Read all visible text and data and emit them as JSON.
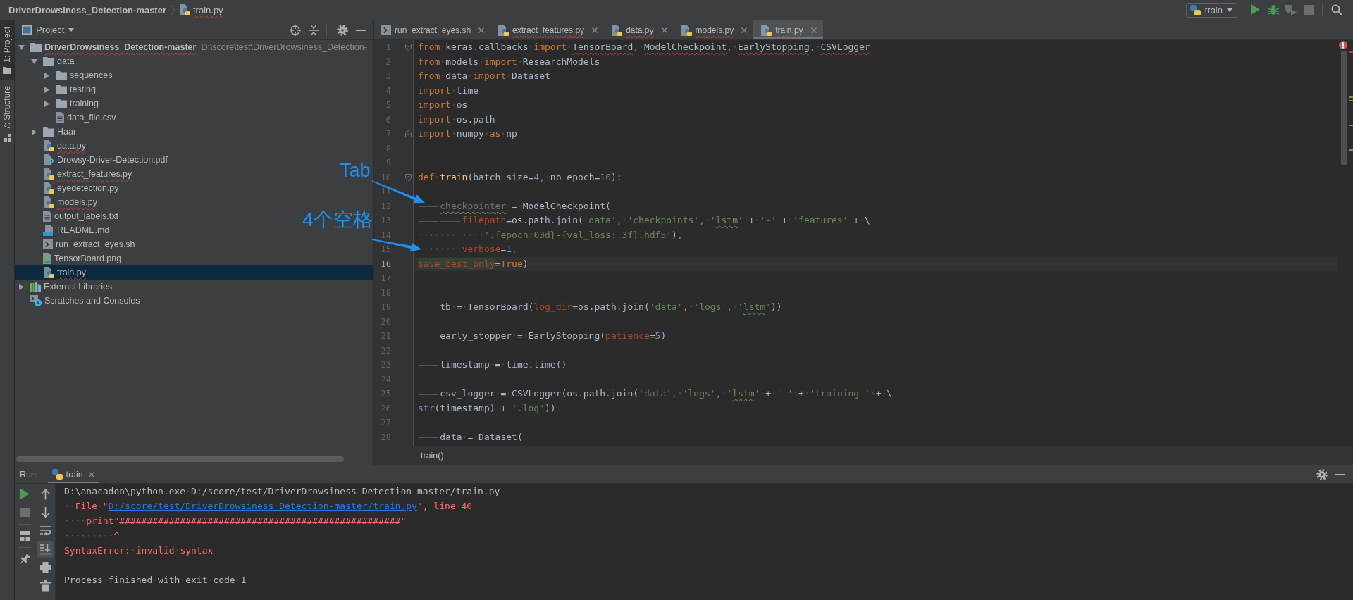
{
  "navigation_bar": {
    "breadcrumbs": [
      {
        "label": "DriverDrowsiness_Detection-master",
        "kind": "project",
        "errors": false
      },
      {
        "label": "train.py",
        "kind": "python",
        "errors": true
      }
    ],
    "run_configuration": {
      "label": "train"
    },
    "toolbar": [
      {
        "kind": "run",
        "disabled": false
      },
      {
        "kind": "debug",
        "disabled": false
      },
      {
        "kind": "coverage",
        "disabled": true
      },
      {
        "kind": "stop",
        "disabled": true
      },
      {
        "kind": "search",
        "disabled": false
      }
    ]
  },
  "tool_window_bar": [
    {
      "label": "1: Project",
      "kind": "project",
      "selected": true
    },
    {
      "label": "7: Structure",
      "kind": "structure",
      "selected": false
    }
  ],
  "project_panel": {
    "title": "Project",
    "tree": [
      {
        "label": "DriverDrowsiness_Detection-master",
        "path": "D:\\score\\test\\DriverDrowsiness_Detection-",
        "kind": "project",
        "expanded": true,
        "selected": false,
        "errors": true,
        "children": [
          {
            "label": "data",
            "kind": "folder",
            "expanded": true,
            "selected": false,
            "errors": false,
            "children": [
              {
                "label": "sequences",
                "kind": "folder",
                "expanded": false,
                "selected": false,
                "errors": false
              },
              {
                "label": "testing",
                "kind": "folder",
                "expanded": false,
                "selected": false,
                "errors": false
              },
              {
                "label": "training",
                "kind": "folder",
                "expanded": false,
                "selected": false,
                "errors": false
              },
              {
                "label": "data_file.csv",
                "kind": "csv",
                "selected": false,
                "errors": false
              }
            ]
          },
          {
            "label": "Haar",
            "kind": "folder",
            "expanded": false,
            "selected": false,
            "errors": false
          },
          {
            "label": "data.py",
            "kind": "python",
            "selected": false,
            "errors": true
          },
          {
            "label": "Drowsy-Driver-Detection.pdf",
            "kind": "unknown",
            "selected": false,
            "errors": false
          },
          {
            "label": "extract_features.py",
            "kind": "python",
            "selected": false,
            "errors": true
          },
          {
            "label": "eyedetection.py",
            "kind": "python",
            "selected": false,
            "errors": false
          },
          {
            "label": "models.py",
            "kind": "python",
            "selected": false,
            "errors": true
          },
          {
            "label": "output_labels.txt",
            "kind": "text",
            "selected": false,
            "errors": false
          },
          {
            "label": "README.md",
            "kind": "markdown",
            "selected": false,
            "errors": false
          },
          {
            "label": "run_extract_eyes.sh",
            "kind": "shell",
            "selected": false,
            "errors": false
          },
          {
            "label": "TensorBoard.png",
            "kind": "image",
            "selected": false,
            "errors": false
          },
          {
            "label": "train.py",
            "kind": "python",
            "selected": true,
            "errors": true
          }
        ]
      },
      {
        "label": "External Libraries",
        "kind": "libraries",
        "expanded": false,
        "selected": false,
        "errors": false
      },
      {
        "label": "Scratches and Consoles",
        "kind": "scratches",
        "selected": false,
        "errors": false
      }
    ]
  },
  "editor": {
    "tabs": [
      {
        "label": "run_extract_eyes.sh",
        "kind": "shell",
        "selected": false,
        "errors": false
      },
      {
        "label": "extract_features.py",
        "kind": "python",
        "selected": false,
        "errors": true
      },
      {
        "label": "data.py",
        "kind": "python",
        "selected": false,
        "errors": true
      },
      {
        "label": "models.py",
        "kind": "python",
        "selected": false,
        "errors": true
      },
      {
        "label": "train.py",
        "kind": "python",
        "selected": true,
        "errors": true
      }
    ],
    "lines": [
      {
        "number": "1",
        "current": false,
        "fold": {
          "kind": "start"
        },
        "tokens": [
          {
            "text": "from",
            "kind": "keyword"
          },
          {
            "text": " keras.callbacks ",
            "kind": "plain"
          },
          {
            "text": "import ",
            "kind": "keyword"
          },
          {
            "text": "TensorBoard",
            "kind": "unresolved"
          },
          {
            "text": ", ",
            "kind": "punctuation"
          },
          {
            "text": "ModelCheckpoint",
            "kind": "unresolved"
          },
          {
            "text": ", ",
            "kind": "punctuation"
          },
          {
            "text": "EarlyStopping",
            "kind": "unresolved"
          },
          {
            "text": ", ",
            "kind": "punctuation"
          },
          {
            "text": "CSVLogger",
            "kind": "unresolved"
          }
        ]
      },
      {
        "number": "2",
        "current": false,
        "tokens": [
          {
            "text": "from",
            "kind": "keyword"
          },
          {
            "text": " models ",
            "kind": "plain"
          },
          {
            "text": "import",
            "kind": "keyword"
          },
          {
            "text": " ResearchModels",
            "kind": "plain"
          }
        ]
      },
      {
        "number": "3",
        "current": false,
        "tokens": [
          {
            "text": "from",
            "kind": "keyword"
          },
          {
            "text": " data ",
            "kind": "plain"
          },
          {
            "text": "import",
            "kind": "keyword"
          },
          {
            "text": " Dataset",
            "kind": "plain"
          }
        ]
      },
      {
        "number": "4",
        "current": false,
        "tokens": [
          {
            "text": "import",
            "kind": "keyword"
          },
          {
            "text": " time",
            "kind": "plain"
          }
        ]
      },
      {
        "number": "5",
        "current": false,
        "tokens": [
          {
            "text": "import",
            "kind": "keyword"
          },
          {
            "text": " os",
            "kind": "plain"
          }
        ]
      },
      {
        "number": "6",
        "current": false,
        "tokens": [
          {
            "text": "import",
            "kind": "keyword"
          },
          {
            "text": " os.path",
            "kind": "plain"
          }
        ]
      },
      {
        "number": "7",
        "current": false,
        "fold": {
          "kind": "end"
        },
        "tokens": [
          {
            "text": "import",
            "kind": "keyword"
          },
          {
            "text": " numpy ",
            "kind": "plain"
          },
          {
            "text": "as",
            "kind": "keyword"
          },
          {
            "text": " np",
            "kind": "plain"
          }
        ]
      },
      {
        "number": "8",
        "current": false
      },
      {
        "number": "9",
        "current": false
      },
      {
        "number": "10",
        "current": false,
        "fold": {
          "kind": "start"
        },
        "tokens": [
          {
            "text": "def ",
            "kind": "keyword"
          },
          {
            "text": "train",
            "kind": "function"
          },
          {
            "text": "(batch_size=",
            "kind": "plain"
          },
          {
            "text": "4",
            "kind": "number"
          },
          {
            "text": ", ",
            "kind": "punctuation"
          },
          {
            "text": "nb_epoch=",
            "kind": "plain"
          },
          {
            "text": "10",
            "kind": "number"
          },
          {
            "text": "):",
            "kind": "plain"
          }
        ]
      },
      {
        "number": "11",
        "current": false
      },
      {
        "number": "12",
        "current": false,
        "tokens": [
          {
            "text": "\tcheckpointer",
            "kind": "unused"
          },
          {
            "text": " = ModelCheckpoint(",
            "kind": "plain"
          }
        ]
      },
      {
        "number": "13",
        "current": false,
        "tokens": [
          {
            "text": "\t\tfilepath",
            "kind": "param"
          },
          {
            "text": "=os.path.join(",
            "kind": "plain"
          },
          {
            "text": "'data'",
            "kind": "string"
          },
          {
            "text": ", ",
            "kind": "punctuation"
          },
          {
            "text": "'checkpoints'",
            "kind": "string"
          },
          {
            "text": ", ",
            "kind": "punctuation"
          },
          {
            "text": "'",
            "kind": "string"
          },
          {
            "text": "lstm",
            "kind": "typo"
          },
          {
            "text": "'",
            "kind": "string"
          },
          {
            "text": " + ",
            "kind": "plain"
          },
          {
            "text": "'-'",
            "kind": "string"
          },
          {
            "text": " + ",
            "kind": "plain"
          },
          {
            "text": "'features'",
            "kind": "string"
          },
          {
            "text": " + \\",
            "kind": "plain"
          }
        ]
      },
      {
        "number": "14",
        "current": false,
        "tokens": [
          {
            "text": "            '.{epoch:03d}-{val_loss:.3f}.hdf5'",
            "kind": "string"
          },
          {
            "text": ")",
            "kind": "plain"
          },
          {
            "text": ",",
            "kind": "punctuation"
          }
        ]
      },
      {
        "number": "15",
        "current": false,
        "tokens": [
          {
            "text": "        verbose",
            "kind": "param"
          },
          {
            "text": "=",
            "kind": "plain"
          },
          {
            "text": "1",
            "kind": "number"
          },
          {
            "text": ",",
            "kind": "punctuation"
          }
        ]
      },
      {
        "number": "16",
        "current": true,
        "tokens": [
          {
            "text": "save_best_only",
            "kind": "param_match"
          },
          {
            "text": "=",
            "kind": "plain"
          },
          {
            "text": "True",
            "kind": "keyword"
          },
          {
            "text": ")",
            "kind": "plain"
          }
        ]
      },
      {
        "number": "17",
        "current": false
      },
      {
        "number": "18",
        "current": false
      },
      {
        "number": "19",
        "current": false,
        "tokens": [
          {
            "text": "\ttb = TensorBoard(",
            "kind": "plain"
          },
          {
            "text": "log_dir",
            "kind": "param"
          },
          {
            "text": "=os.path.join(",
            "kind": "plain"
          },
          {
            "text": "'data'",
            "kind": "string"
          },
          {
            "text": ", ",
            "kind": "punctuation"
          },
          {
            "text": "'logs'",
            "kind": "string"
          },
          {
            "text": ", ",
            "kind": "punctuation"
          },
          {
            "text": "'",
            "kind": "string"
          },
          {
            "text": "lstm",
            "kind": "typo"
          },
          {
            "text": "'",
            "kind": "string"
          },
          {
            "text": "))",
            "kind": "plain"
          }
        ]
      },
      {
        "number": "20",
        "current": false
      },
      {
        "number": "21",
        "current": false,
        "tokens": [
          {
            "text": "\tearly_stopper = EarlyStopping(",
            "kind": "plain"
          },
          {
            "text": "patience",
            "kind": "param"
          },
          {
            "text": "=",
            "kind": "plain"
          },
          {
            "text": "5",
            "kind": "number"
          },
          {
            "text": ")",
            "kind": "plain"
          }
        ]
      },
      {
        "number": "22",
        "current": false
      },
      {
        "number": "23",
        "current": false,
        "tokens": [
          {
            "text": "\ttimestamp = time.time()",
            "kind": "plain"
          }
        ]
      },
      {
        "number": "24",
        "current": false
      },
      {
        "number": "25",
        "current": false,
        "tokens": [
          {
            "text": "\tcsv_logger = CSVLogger(os.path.join(",
            "kind": "plain"
          },
          {
            "text": "'data'",
            "kind": "string"
          },
          {
            "text": ", ",
            "kind": "punctuation"
          },
          {
            "text": "'logs'",
            "kind": "string"
          },
          {
            "text": ", ",
            "kind": "punctuation"
          },
          {
            "text": "'",
            "kind": "string"
          },
          {
            "text": "lstm",
            "kind": "typo"
          },
          {
            "text": "'",
            "kind": "string"
          },
          {
            "text": " + ",
            "kind": "plain"
          },
          {
            "text": "'-'",
            "kind": "string"
          },
          {
            "text": " + ",
            "kind": "plain"
          },
          {
            "text": "'training-'",
            "kind": "string"
          },
          {
            "text": " + \\",
            "kind": "plain"
          }
        ]
      },
      {
        "number": "26",
        "current": false,
        "tokens": [
          {
            "text": "str",
            "kind": "builtin"
          },
          {
            "text": "(timestamp) + ",
            "kind": "plain"
          },
          {
            "text": "'.log'",
            "kind": "string"
          },
          {
            "text": "))",
            "kind": "plain"
          }
        ]
      },
      {
        "number": "27",
        "current": false
      },
      {
        "number": "28",
        "current": false,
        "tokens": [
          {
            "text": "\tdata = Dataset(",
            "kind": "plain"
          }
        ]
      }
    ],
    "breadcrumb": "train()"
  },
  "run_panel": {
    "title": "Run:",
    "tabs": [
      {
        "label": "train",
        "selected": true
      }
    ],
    "toolbar": [
      {
        "groups": [
          {
            "buttons": [
              {
                "kind": "rerun",
                "disabled": false,
                "on": false
              },
              {
                "kind": "stop",
                "disabled": true,
                "on": false
              }
            ]
          },
          {
            "buttons": [
              {
                "kind": "layout",
                "disabled": false,
                "on": false
              }
            ]
          },
          {
            "buttons": [
              {
                "kind": "pin",
                "disabled": false,
                "on": false
              }
            ]
          }
        ]
      },
      {
        "groups": [
          {
            "buttons": [
              {
                "kind": "up",
                "disabled": false,
                "on": false
              },
              {
                "kind": "down",
                "disabled": false,
                "on": false
              },
              {
                "kind": "wrap",
                "disabled": false,
                "on": false
              },
              {
                "kind": "scroll_end",
                "disabled": false,
                "on": true
              },
              {
                "kind": "print",
                "disabled": false,
                "on": false
              },
              {
                "kind": "trash",
                "disabled": false,
                "on": false
              }
            ]
          }
        ]
      }
    ],
    "console": [
      {
        "kind": "stdout",
        "segments": [
          {
            "text": "D:\\anacadon\\python.exe D:/score/test/DriverDrowsiness_Detection-master/train.py",
            "kind": "text"
          }
        ]
      },
      {
        "kind": "stderr",
        "segments": [
          {
            "text": "  File \"",
            "kind": "text"
          },
          {
            "text": "D:/score/test/DriverDrowsiness_Detection-master/train.py",
            "kind": "link"
          },
          {
            "text": "\", line 40",
            "kind": "text"
          }
        ]
      },
      {
        "kind": "stderr",
        "segments": [
          {
            "text": "    print\"###################################################\"",
            "kind": "text"
          }
        ]
      },
      {
        "kind": "stderr",
        "segments": [
          {
            "text": "         ^",
            "kind": "text"
          }
        ]
      },
      {
        "kind": "stderr",
        "segments": [
          {
            "text": "SyntaxError: invalid syntax",
            "kind": "text"
          }
        ]
      },
      {
        "kind": "exit",
        "segments": [
          {
            "text": "Process finished with exit code 1",
            "kind": "text"
          }
        ]
      }
    ]
  },
  "annotations": [
    {
      "text": "Tab"
    },
    {
      "text": "4个空格"
    }
  ]
}
